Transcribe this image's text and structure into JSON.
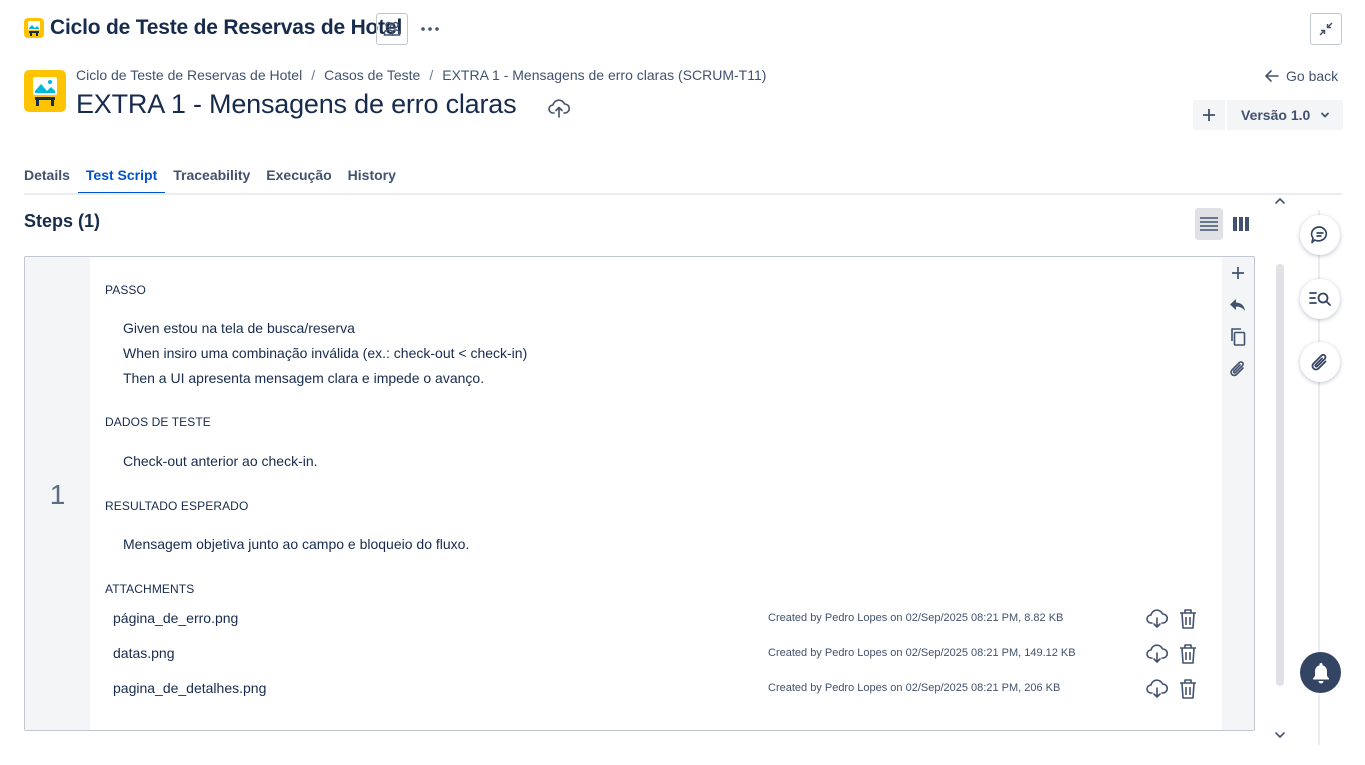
{
  "header": {
    "app_title": "Ciclo de Teste de Reservas de Hotel",
    "icons": [
      "bus-app-icon",
      "people-icon",
      "more-icon",
      "collapse-icon"
    ]
  },
  "breadcrumb": {
    "items": [
      "Ciclo de Teste de Reservas de Hotel",
      "Casos de Teste",
      "EXTRA 1 - Mensagens de erro claras (SCRUM-T11)"
    ],
    "separator": "/"
  },
  "page": {
    "title": "EXTRA 1 - Mensagens de erro claras",
    "go_back": "Go back",
    "version_label": "Versão 1.0"
  },
  "tabs": [
    {
      "label": "Details",
      "active": false
    },
    {
      "label": "Test Script",
      "active": true
    },
    {
      "label": "Traceability",
      "active": false
    },
    {
      "label": "Execução",
      "active": false
    },
    {
      "label": "History",
      "active": false
    }
  ],
  "steps": {
    "title": "Steps (1)",
    "step_number": "1",
    "passo_label": "PASSO",
    "passo_lines": [
      "Given estou na tela de busca/reserva",
      "When insiro uma combinação inválida (ex.: check-out < check-in)",
      "Then a UI apresenta mensagem clara e impede o avanço."
    ],
    "dados_label": "DADOS DE TESTE",
    "dados_text": "Check-out anterior ao check-in.",
    "resultado_label": "RESULTADO ESPERADO",
    "resultado_text": "Mensagem objetiva junto ao campo e bloqueio do fluxo.",
    "attachments_label": "ATTACHMENTS",
    "attachments": [
      {
        "name": "página_de_erro.png",
        "meta": "Created by Pedro Lopes on 02/Sep/2025 08:21 PM, 8.82 KB"
      },
      {
        "name": "datas.png",
        "meta": "Created by Pedro Lopes on 02/Sep/2025 08:21 PM, 149.12 KB"
      },
      {
        "name": "pagina_de_detalhes.png",
        "meta": "Created by Pedro Lopes on 02/Sep/2025 08:21 PM, 206 KB"
      }
    ]
  },
  "colors": {
    "accent": "#0052cc",
    "text": "#172b4d",
    "subtle": "#42526e",
    "panel": "#f4f5f7",
    "app_icon": "#ffc400"
  }
}
